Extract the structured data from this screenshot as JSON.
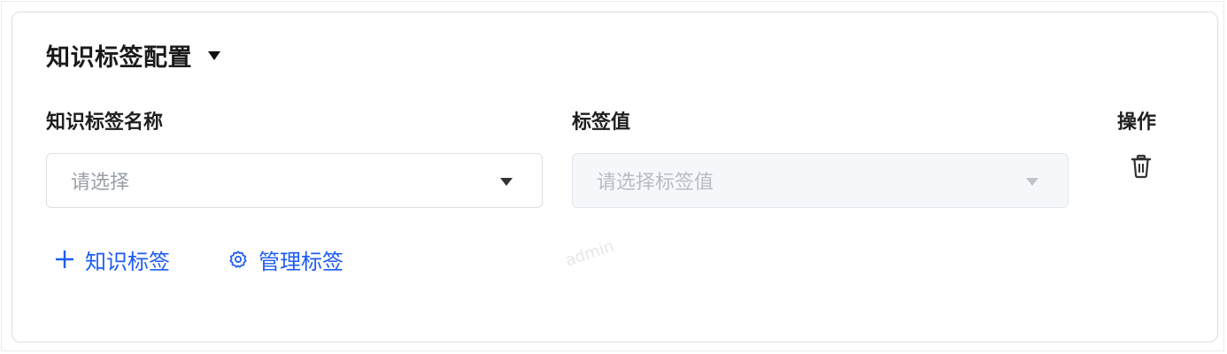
{
  "section": {
    "title": "知识标签配置"
  },
  "columns": {
    "name_label": "知识标签名称",
    "value_label": "标签值",
    "action_label": "操作"
  },
  "row": {
    "name_select": {
      "placeholder": "请选择",
      "value": ""
    },
    "value_select": {
      "placeholder": "请选择标签值",
      "value": "",
      "disabled": true
    }
  },
  "actions": {
    "add_label": "知识标签",
    "manage_label": "管理标签"
  },
  "watermark": "admin",
  "colors": {
    "link": "#1d5cf5",
    "border": "#dcdfe6",
    "placeholder": "#9aa0a8",
    "disabled_bg": "#f5f7fa"
  }
}
